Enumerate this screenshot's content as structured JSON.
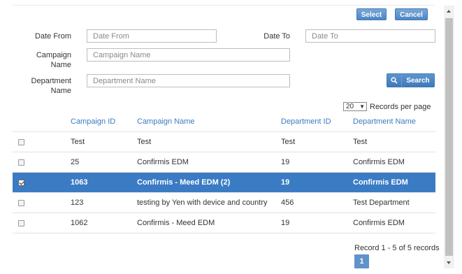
{
  "toolbar": {
    "select_label": "Select",
    "cancel_label": "Cancel"
  },
  "filters": {
    "date_from": {
      "label": "Date From",
      "placeholder": "Date From",
      "value": ""
    },
    "date_to": {
      "label": "Date To",
      "placeholder": "Date To",
      "value": ""
    },
    "campaign_name": {
      "label_line1": "Campaign",
      "label_line2": "Name",
      "placeholder": "Campaign Name",
      "value": ""
    },
    "department_name": {
      "label_line1": "Department",
      "label_line2": "Name",
      "placeholder": "Department Name",
      "value": ""
    },
    "search_label": "Search"
  },
  "records_per_page": {
    "value": "20",
    "label": "Records per page"
  },
  "table": {
    "headers": [
      "Campaign ID",
      "Campaign Name",
      "Department ID",
      "Department Name"
    ],
    "rows": [
      {
        "checked": false,
        "campaign_id": "Test",
        "campaign_name": "Test",
        "department_id": "Test",
        "department_name": "Test"
      },
      {
        "checked": false,
        "campaign_id": "25",
        "campaign_name": "Confirmis EDM",
        "department_id": "19",
        "department_name": "Confirmis EDM"
      },
      {
        "checked": true,
        "campaign_id": "1063",
        "campaign_name": "Confirmis - Meed EDM (2)",
        "department_id": "19",
        "department_name": "Confirmis EDM"
      },
      {
        "checked": false,
        "campaign_id": "123",
        "campaign_name": "testing by Yen with device and country",
        "department_id": "456",
        "department_name": "Test Department"
      },
      {
        "checked": false,
        "campaign_id": "1062",
        "campaign_name": "Confirmis - Meed EDM",
        "department_id": "19",
        "department_name": "Confirmis EDM"
      }
    ]
  },
  "pagination": {
    "record_text": "Record 1 - 5 of 5 records",
    "current_page": "1"
  },
  "colors": {
    "accent": "#3a7bc4",
    "header_text": "#3a7bbf"
  }
}
